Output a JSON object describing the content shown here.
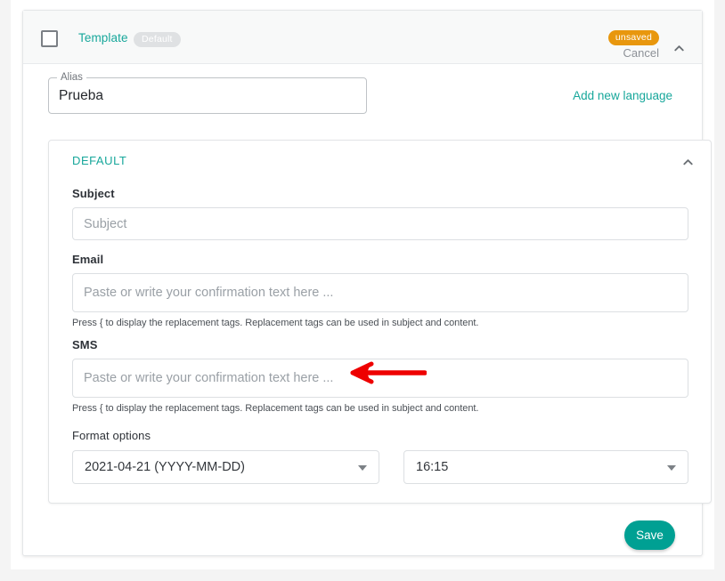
{
  "colors": {
    "teal": "#17a79b",
    "save_button": "#00a093",
    "unsaved_badge": "#e8970e",
    "default_badge": "#dfe1e3",
    "annotation_arrow": "#ee0000"
  },
  "header": {
    "checkbox_checked": false,
    "title": "Template",
    "default_badge": "Default",
    "unsaved_badge": "unsaved",
    "cancel_label": "Cancel",
    "collapse_icon": "chevron-up-icon"
  },
  "alias": {
    "label": "Alias",
    "value": "Prueba",
    "add_language_link": "Add new language"
  },
  "section": {
    "title": "DEFAULT",
    "collapse_icon": "chevron-up-icon"
  },
  "fields": {
    "subject": {
      "label": "Subject",
      "value": "",
      "placeholder": "Subject"
    },
    "email": {
      "label": "Email",
      "value": "",
      "placeholder": "Paste or write your confirmation text here ...",
      "helper": "Press { to display the replacement tags. Replacement tags can be used in subject and content."
    },
    "sms": {
      "label": "SMS",
      "value": "",
      "placeholder": "Paste or write your confirmation text here ...",
      "helper": "Press { to display the replacement tags. Replacement tags can be used in subject and content."
    }
  },
  "format_options": {
    "label": "Format options",
    "date_format": "2021-04-21 (YYYY-MM-DD)",
    "time_format": "16:15"
  },
  "footer": {
    "save_label": "Save"
  },
  "annotation": {
    "type": "arrow",
    "direction": "left",
    "target": "sms-input"
  }
}
